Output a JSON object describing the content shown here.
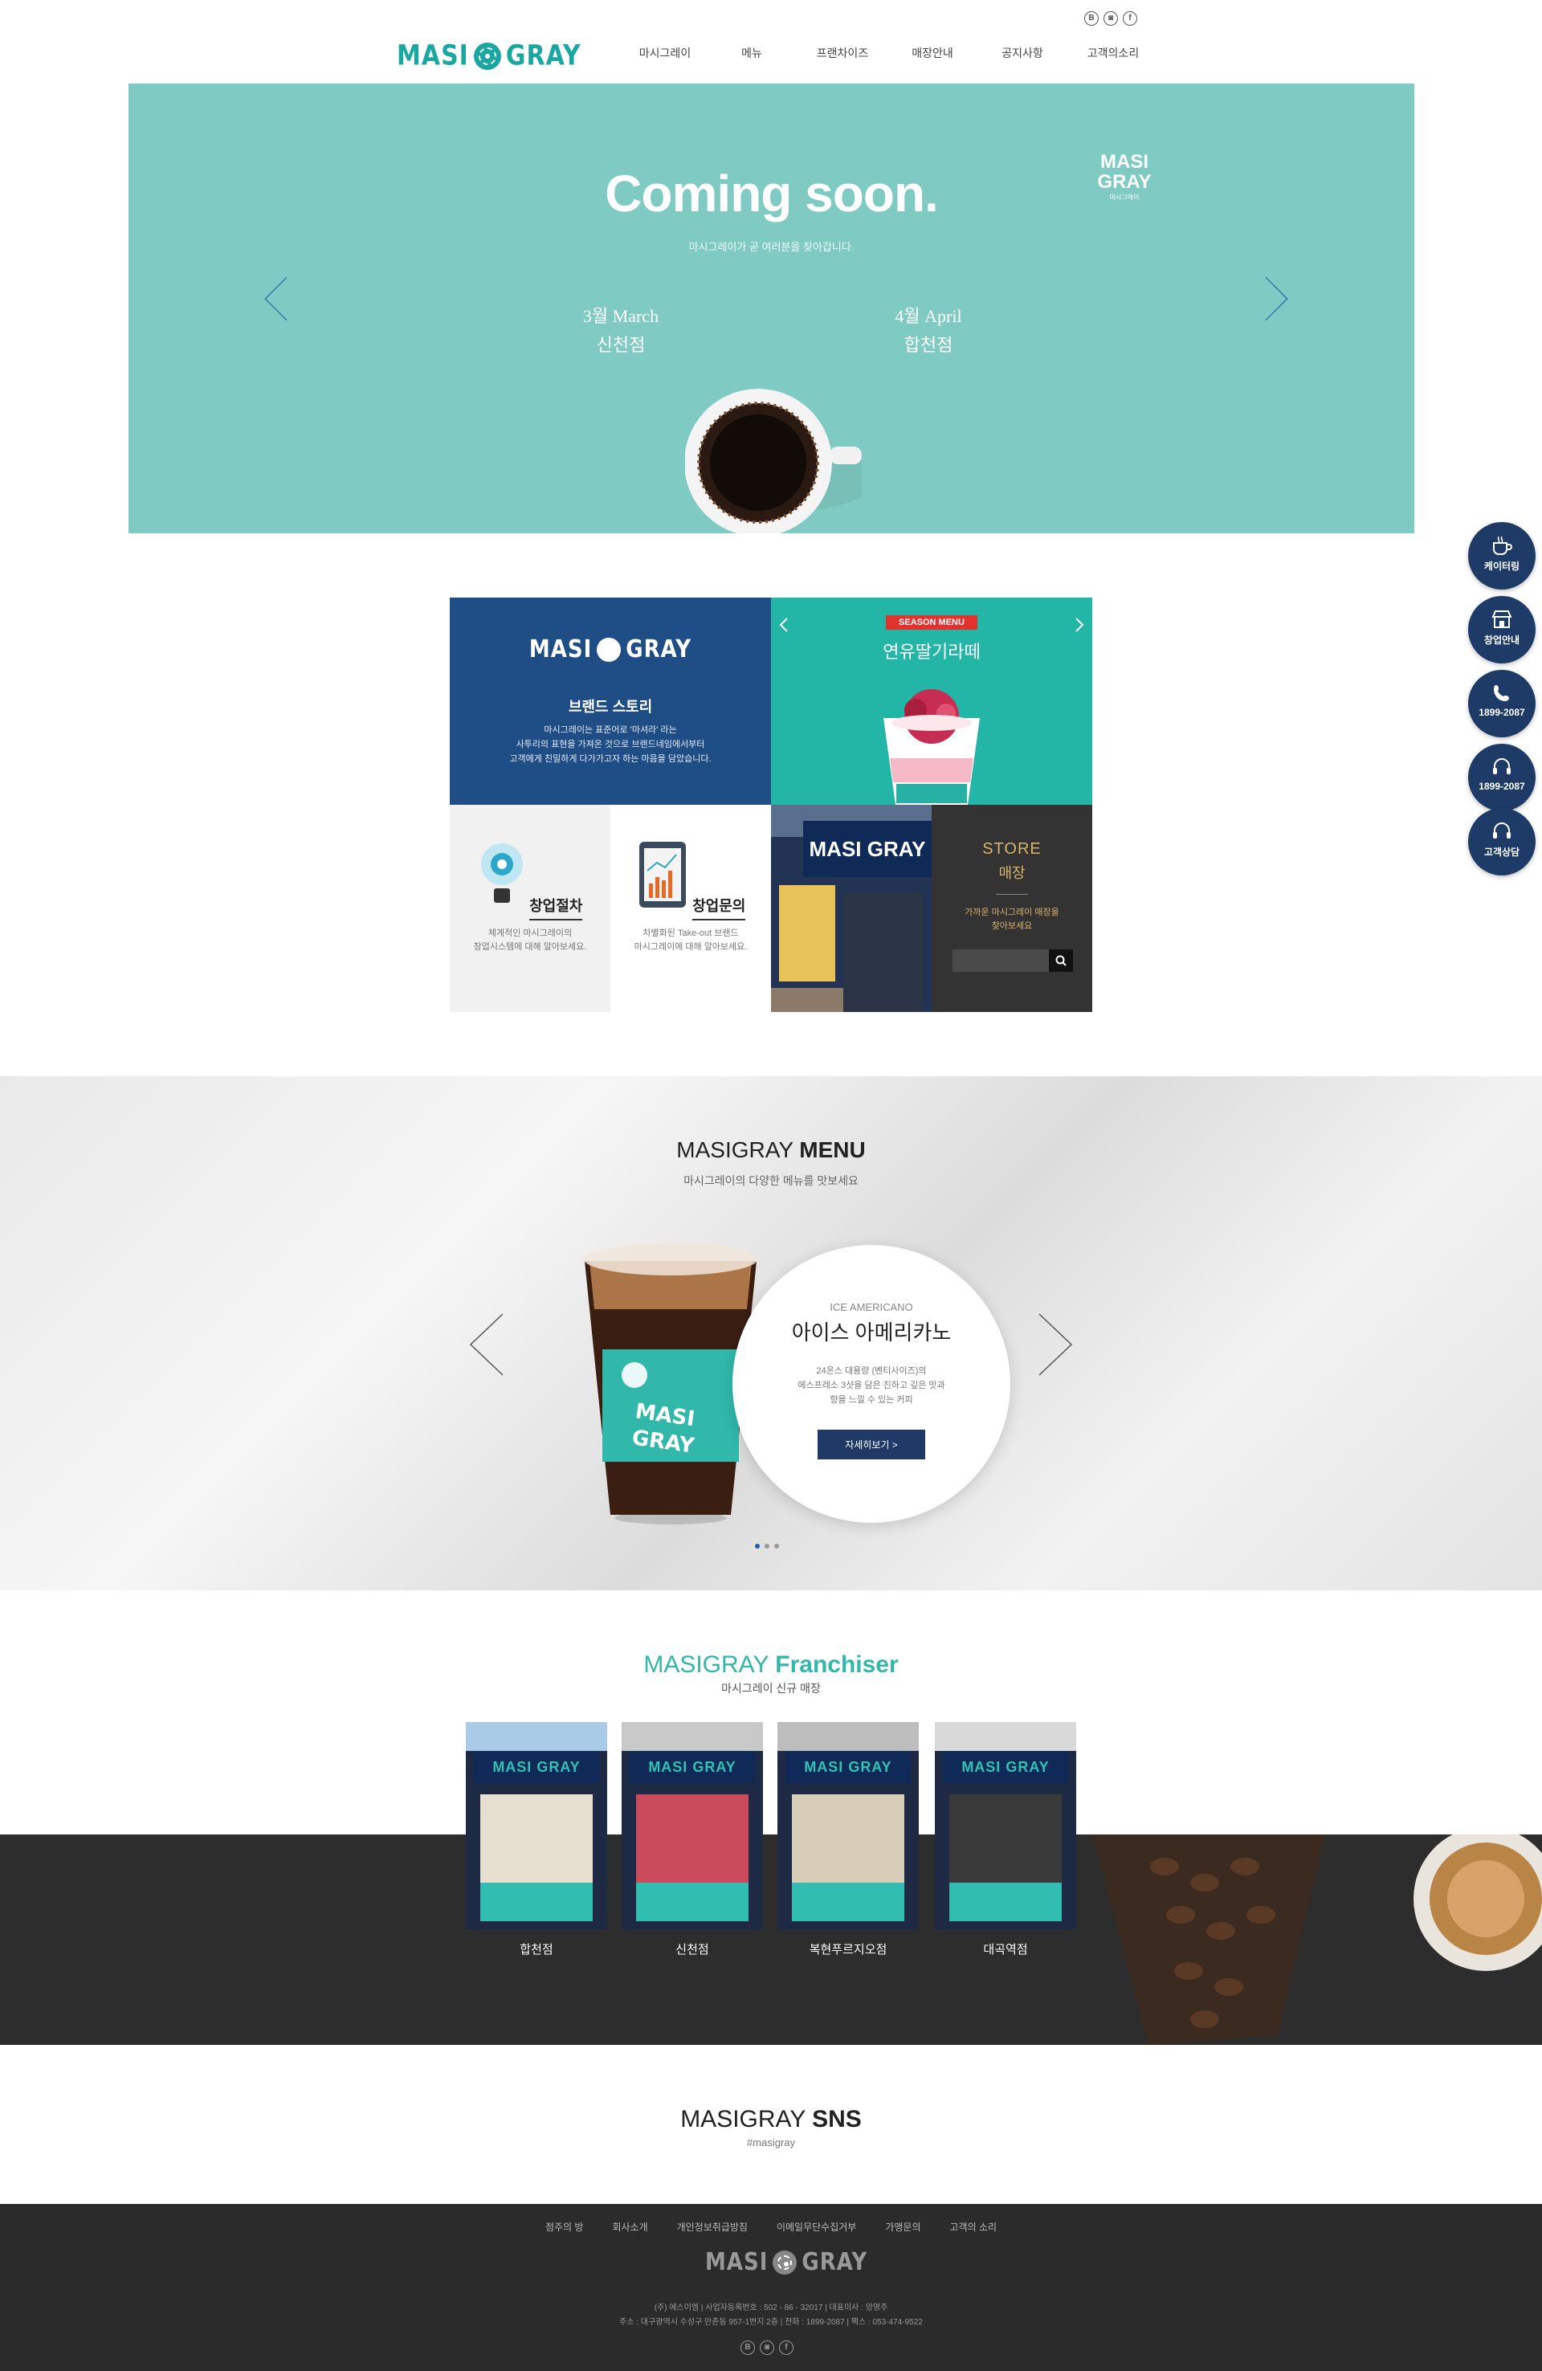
{
  "header": {
    "logo_left": "MASI",
    "logo_right": "GRAY",
    "nav": [
      "마시그레이",
      "메뉴",
      "프랜차이즈",
      "매장안내",
      "공지사항",
      "고객의소리"
    ],
    "top_icons": [
      "blog-icon",
      "instagram-icon",
      "facebook-icon"
    ]
  },
  "hero": {
    "title": "Coming soon.",
    "subtitle": "마시그레이가 곧 여러분을 찾아갑니다.",
    "dates": [
      {
        "month": "3월 March",
        "store": "신천점"
      },
      {
        "month": "4월 April",
        "store": "합천점"
      }
    ],
    "badge_top": "MASI",
    "badge_mid": "GRAY",
    "badge_sub": "마시그레이",
    "bg_color": "#7fcac2"
  },
  "side_buttons": [
    {
      "label": "케이터링",
      "icon": "coffee-cup-icon"
    },
    {
      "label": "창업안내",
      "icon": "store-icon"
    },
    {
      "label": "1899-2087",
      "icon": "phone-icon"
    },
    {
      "label": "1899-2087",
      "icon": "headset-icon"
    },
    {
      "label": "고객상담",
      "icon": "headset-icon"
    }
  ],
  "grid": {
    "brand": {
      "logo_left": "MASI",
      "logo_right": "GRAY",
      "title": "브랜드 스토리",
      "lines": [
        "마시그레이는 표준어로 '마셔라' 라는",
        "사투리의 표현을 가져온 것으로 브랜드네임에서부터",
        "고객에게 친밀하게 다가가고자 하는 마음을 담았습니다."
      ]
    },
    "season": {
      "badge": "SEASON MENU",
      "title": "연유딸기라떼"
    },
    "process": {
      "title": "창업절차",
      "lines": [
        "체계적인 마시그레이의",
        "창업시스템에 대해 알아보세요."
      ]
    },
    "inquiry": {
      "title": "창업문의",
      "lines": [
        "차별화된 Take-out 브랜드",
        "마시그레이에 대해 알아보세요."
      ]
    },
    "store": {
      "title_en": "STORE",
      "title_ko": "매장",
      "lines": [
        "가까운 마시그레이 매장을",
        "찾아보세요"
      ],
      "search_placeholder": ""
    }
  },
  "menu": {
    "title_light": "MASIGRAY ",
    "title_bold": "MENU",
    "subtitle": "마시그레이의 다양한 메뉴를 맛보세요",
    "item_en": "ICE AMERICANO",
    "item_ko": "아이스 아메리카노",
    "desc": [
      "24온스 대용량 (벤티사이즈)의",
      "에스프레소 3샷을 담은 진하고 깊은 맛과",
      "향을 느낄 수 있는 커피"
    ],
    "button": "자세히보기 >",
    "cup_text_1": "MASI",
    "cup_text_2": "GRAY",
    "dots": 3
  },
  "franchiser": {
    "title_light": "MASIGRAY ",
    "title_bold": "Franchiser",
    "subtitle": "마시그레이 신규 매장",
    "shops": [
      "합천점",
      "신천점",
      "복현푸르지오점",
      "대곡역점"
    ],
    "sign_text": "MASI GRAY"
  },
  "sns": {
    "title_light": "MASIGRAY ",
    "title_bold": "SNS",
    "tag": "#masigray"
  },
  "footer": {
    "nav": [
      "점주의 방",
      "회사소개",
      "개인정보취급방침",
      "이메일무단수집거부",
      "가맹문의",
      "고객의 소리"
    ],
    "logo_left": "MASI",
    "logo_right": "GRAY",
    "info_1": "(주) 에스이엠   |   사업자등록번호 : 502 - 86 - 32017   |   대표이사 : 양영주",
    "info_2": "주소 : 대구광역시 수성구 만촌동 957-1번지 2층   |   전화 : 1899-2087   |   팩스 : 053-474-9522"
  }
}
